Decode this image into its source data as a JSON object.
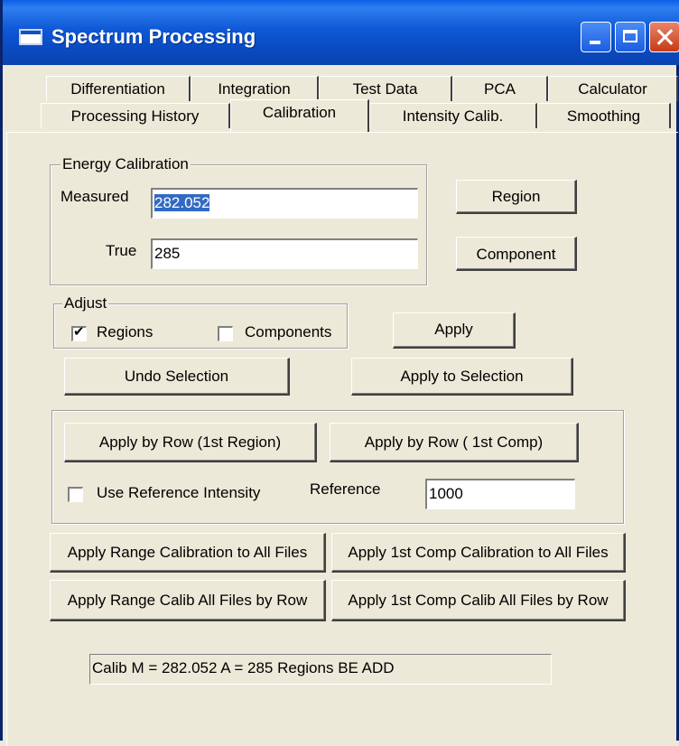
{
  "window": {
    "title": "Spectrum Processing"
  },
  "tabs_row1": [
    "Differentiation",
    "Integration",
    "Test Data",
    "PCA",
    "Calculator"
  ],
  "tabs_row2": [
    "Processing History",
    "Calibration",
    "Intensity Calib.",
    "Smoothing"
  ],
  "active_tab": "Calibration",
  "energy": {
    "legend": "Energy Calibration",
    "measured_label": "Measured",
    "measured_value": "282.052",
    "true_label": "True",
    "true_value": "285",
    "region_button": "Region",
    "component_button": "Component"
  },
  "adjust": {
    "legend": "Adjust",
    "regions_label": "Regions",
    "regions_checked": true,
    "components_label": "Components",
    "components_checked": false,
    "apply_button": "Apply"
  },
  "undo_selection_button": "Undo Selection",
  "apply_to_selection_button": "Apply to Selection",
  "row": {
    "apply_row_region_button": "Apply by Row (1st Region)",
    "apply_row_comp_button": "Apply by Row ( 1st Comp)",
    "use_ref_label": "Use Reference Intensity",
    "use_ref_checked": false,
    "reference_label": "Reference",
    "reference_value": "1000"
  },
  "all_files": {
    "range_all": "Apply Range Calibration to All Files",
    "comp_all": "Apply 1st Comp Calibration to All Files",
    "range_row": "Apply Range Calib All Files by Row",
    "comp_row": "Apply 1st Comp Calib All Files by Row"
  },
  "status_text": "Calib M = 282.052 A = 285 Regions BE ADD",
  "colors": {
    "titlebar": "#0a4ac2",
    "face": "#ece9d8",
    "selection": "#316ac5",
    "close": "#c63a16"
  }
}
